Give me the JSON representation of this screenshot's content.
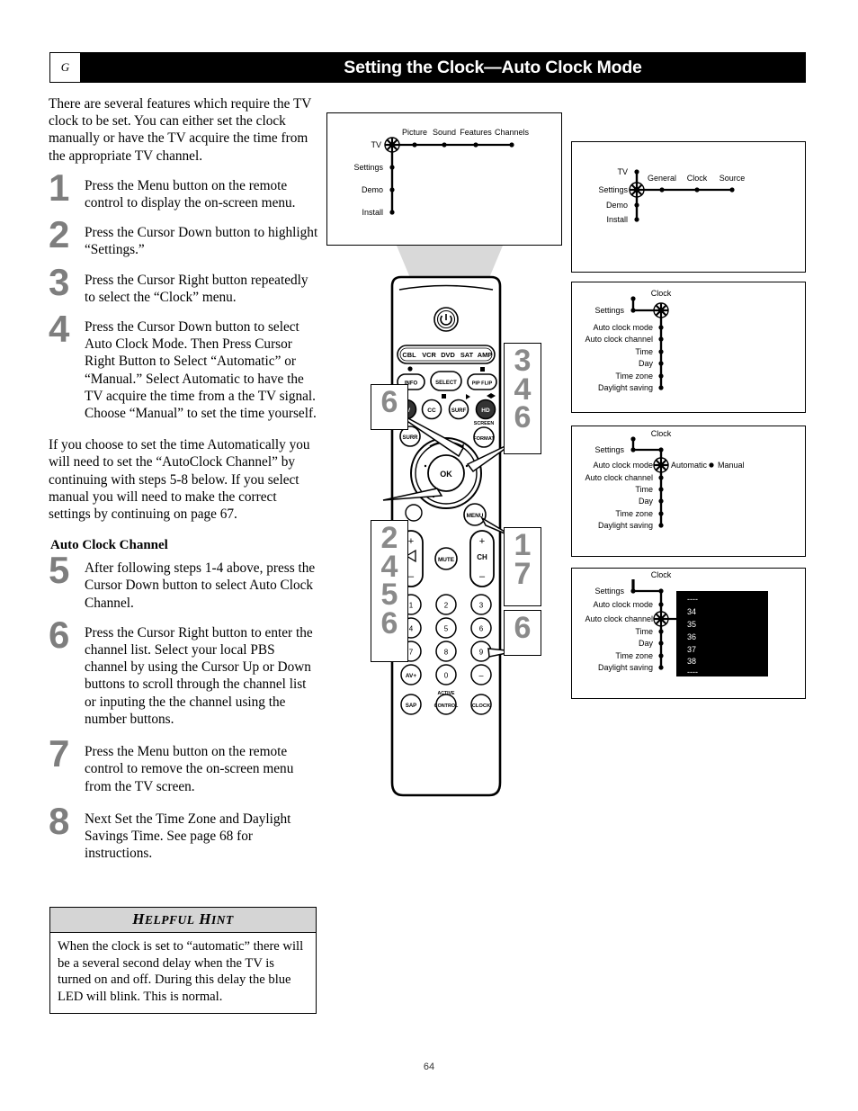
{
  "header": {
    "tab_letter": "G",
    "title": "Setting the Clock—Auto Clock Mode"
  },
  "intro": "There are several features which require the TV clock to be set.  You can either set the clock manually or have the TV acquire the time from the appropriate TV channel.",
  "steps": [
    {
      "num": "1",
      "text": "Press the Menu button on the remote control to display the on-screen menu."
    },
    {
      "num": "2",
      "text": "Press the Cursor Down button to highlight “Settings.”"
    },
    {
      "num": "3",
      "text": "Press the Cursor Right button repeatedly to select the “Clock” menu."
    },
    {
      "num": "4",
      "text": "Press the Cursor Down button to select Auto Clock Mode.  Then Press Cursor Right Button to Select “Automatic” or “Manual.”  Select Automatic to have the TV acquire the time from a the TV signal.  Choose “Manual” to set the time yourself."
    }
  ],
  "mid_para": "If you choose to set the time Automatically you will need to set the “AutoClock Channel” by continuing with steps 5-8 below.  If you select manual you will need to make the correct settings by continuing on page 67.",
  "subheading": "Auto Clock Channel",
  "steps2": [
    {
      "num": "5",
      "text": "After following steps 1-4 above, press the Cursor Down button to select Auto Clock Channel."
    },
    {
      "num": "6",
      "text": "Press the Cursor Right button to enter the channel list.  Select your local PBS channel by using the Cursor Up or Down buttons to scroll through the channel list or inputing the the channel using the number buttons."
    },
    {
      "num": "7",
      "text": "Press the Menu button on the remote control to remove the on-screen menu from the TV screen."
    },
    {
      "num": "8",
      "text": "Next Set the Time Zone and Daylight Savings Time.  See page 68 for instructions."
    }
  ],
  "hint": {
    "title_lead": "H",
    "title_rest_a": "ELPFUL",
    "title_lead_b": "H",
    "title_rest_b": "INT",
    "title_full": "HELPFUL HINT",
    "body": "When the clock is set to “automatic” there will be a several second delay when the TV is turned on and off.  During this delay the blue LED will blink.  This is normal."
  },
  "page_number": "64",
  "menus": [
    {
      "id": "menu-tv",
      "selected": "TV",
      "vertical": [
        "TV",
        "Settings",
        "Demo",
        "Install"
      ],
      "horizontal": [
        "Picture",
        "Sound",
        "Features",
        "Channels"
      ],
      "options": []
    },
    {
      "id": "menu-settings",
      "selected": "Settings",
      "vertical": [
        "TV",
        "Settings",
        "Demo",
        "Install"
      ],
      "horizontal": [
        "General",
        "Clock",
        "Source"
      ],
      "options": []
    },
    {
      "id": "menu-clock",
      "selected": "Clock",
      "parent": "Settings",
      "branch": "Clock",
      "vertical": [
        "Auto clock mode",
        "Auto clock channel",
        "Time",
        "Day",
        "Time zone",
        "Daylight saving"
      ],
      "options": []
    },
    {
      "id": "menu-auto-clock-mode",
      "selected": "Auto clock mode",
      "parent": "Settings",
      "branch": "Clock",
      "vertical": [
        "Auto clock mode",
        "Auto clock channel",
        "Time",
        "Day",
        "Time zone",
        "Daylight saving"
      ],
      "options": [
        "Automatic",
        "Manual"
      ]
    },
    {
      "id": "menu-auto-clock-channel",
      "selected": "Auto clock channel",
      "parent": "Settings",
      "branch": "Clock",
      "vertical": [
        "Auto clock mode",
        "Auto clock channel",
        "Time",
        "Day",
        "Time zone",
        "Daylight saving"
      ],
      "channel_list": [
        "----",
        "34",
        "35",
        "36",
        "37",
        "38",
        "----"
      ]
    }
  ],
  "remote": {
    "device_buttons": [
      "CBL",
      "VCR",
      "DVD",
      "SAT",
      "AMP"
    ],
    "row_info": [
      "INFO",
      "SELECT",
      "PIP FLIP"
    ],
    "row_cc": [
      "TV",
      "CC",
      "SURF",
      "HD"
    ],
    "screen_format_label": "SCREEN",
    "screen_format_button": "FORMAT",
    "surround_button": "SURR",
    "ok_button": "OK",
    "menu_button": "MENU",
    "mute_button": "MUTE",
    "volume_label": "VOL",
    "channel_label": "CH",
    "keypad": [
      "1",
      "2",
      "3",
      "4",
      "5",
      "6",
      "7",
      "8",
      "9",
      "AV+",
      "0",
      "–"
    ],
    "bottom_row": [
      "SAP",
      "CONTROL",
      "CLOCK"
    ],
    "active_label": "ACTIVE"
  },
  "callouts": [
    {
      "id": "callout-cursor-up",
      "numbers": [
        "6"
      ]
    },
    {
      "id": "callout-cursor-right",
      "numbers": [
        "3",
        "4",
        "6"
      ]
    },
    {
      "id": "callout-cursor-down",
      "numbers": [
        "2",
        "4",
        "5",
        "6"
      ]
    },
    {
      "id": "callout-menu",
      "numbers": [
        "1",
        "7"
      ]
    },
    {
      "id": "callout-numbers",
      "numbers": [
        "6"
      ]
    }
  ],
  "colors": {
    "callout_gray": "#8a8a8a",
    "step_number_gray": "#7e7e7e",
    "header_black": "#000000",
    "hint_title_bg": "#d5d5d5",
    "cone_gray": "#d9d9d9"
  }
}
